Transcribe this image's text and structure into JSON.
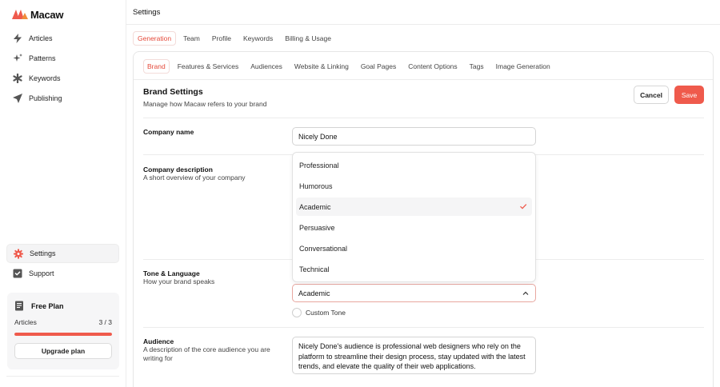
{
  "app": {
    "name": "Macaw",
    "logo_icon": "macaw-logo-icon",
    "accent": "#ef5a4c"
  },
  "sidebar": {
    "items": [
      {
        "label": "Articles",
        "icon": "bolt-icon"
      },
      {
        "label": "Patterns",
        "icon": "sparkle-icon"
      },
      {
        "label": "Keywords",
        "icon": "asterisk-icon"
      },
      {
        "label": "Publishing",
        "icon": "send-icon"
      }
    ],
    "bottom_items": [
      {
        "label": "Settings",
        "icon": "gear-icon",
        "active": true
      },
      {
        "label": "Support",
        "icon": "support-icon"
      }
    ],
    "plan": {
      "title": "Free Plan",
      "usage_label": "Articles",
      "usage_value": "3 / 3",
      "usage_fraction": 1.0,
      "upgrade_label": "Upgrade plan"
    }
  },
  "header": {
    "title": "Settings"
  },
  "tabs": [
    {
      "label": "Generation",
      "active": true
    },
    {
      "label": "Team"
    },
    {
      "label": "Profile"
    },
    {
      "label": "Keywords"
    },
    {
      "label": "Billing & Usage"
    }
  ],
  "subtabs": [
    {
      "label": "Brand",
      "active": true
    },
    {
      "label": "Features & Services"
    },
    {
      "label": "Audiences"
    },
    {
      "label": "Website & Linking"
    },
    {
      "label": "Goal Pages"
    },
    {
      "label": "Content Options"
    },
    {
      "label": "Tags"
    },
    {
      "label": "Image Generation"
    }
  ],
  "section": {
    "title": "Brand Settings",
    "subtitle": "Manage how Macaw refers to your brand",
    "cancel_label": "Cancel",
    "save_label": "Save"
  },
  "fields": {
    "company_name": {
      "label": "Company name",
      "value": "Nicely Done"
    },
    "company_description": {
      "label": "Company description",
      "help": "A short overview of your company"
    },
    "tone": {
      "label": "Tone & Language",
      "help": "How your brand speaks",
      "selected": "Academic",
      "options": [
        "Professional",
        "Humorous",
        "Academic",
        "Persuasive",
        "Conversational",
        "Technical"
      ],
      "custom_label": "Custom Tone"
    },
    "audience": {
      "label": "Audience",
      "help": "A description of the core audience you are writing for",
      "value": "Nicely Done's audience is professional web designers who rely on the platform to streamline their design process, stay updated with the latest trends, and elevate the quality of their web applications."
    }
  }
}
